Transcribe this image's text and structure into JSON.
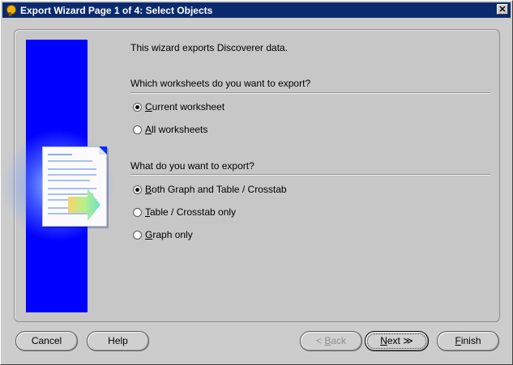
{
  "window": {
    "title": "Export Wizard Page 1 of 4: Select Objects",
    "close_glyph": "✕"
  },
  "intro_text": "This wizard exports Discoverer data.",
  "section1": {
    "question": "Which worksheets do you want to export?",
    "options": [
      {
        "mnemonic": "C",
        "rest": "urrent worksheet",
        "selected": true
      },
      {
        "mnemonic": "A",
        "rest": "ll worksheets",
        "selected": false
      }
    ]
  },
  "section2": {
    "question": "What do you want to export?",
    "options": [
      {
        "mnemonic": "B",
        "rest": "oth Graph and Table / Crosstab",
        "selected": true
      },
      {
        "mnemonic": "T",
        "rest": "able / Crosstab only",
        "selected": false
      },
      {
        "mnemonic": "G",
        "rest": "raph only",
        "selected": false
      }
    ]
  },
  "buttons": {
    "cancel": "Cancel",
    "help": "Help",
    "back": {
      "glyph": "<",
      "mnemonic": "B",
      "rest": "ack",
      "enabled": false
    },
    "next": {
      "mnemonic": "N",
      "rest": "ext",
      "glyph": "≫"
    },
    "finish": {
      "mnemonic": "F",
      "rest": "inish"
    }
  },
  "colors": {
    "titlebar": "#0b2a6e",
    "banner": "#0000ff",
    "background": "#c7c7c7"
  }
}
